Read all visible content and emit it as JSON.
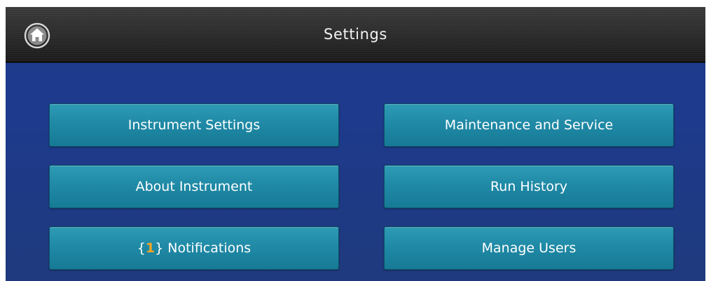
{
  "header": {
    "title": "Settings",
    "home_icon": "home-icon"
  },
  "colors": {
    "background": "#1e3a8a",
    "button": "#208aa6",
    "notification_count": "#f5a623"
  },
  "menu": {
    "instrument_settings": "Instrument Settings",
    "maintenance_service": "Maintenance and Service",
    "about_instrument": "About Instrument",
    "run_history": "Run History",
    "notifications": {
      "open_brace": "{",
      "count": "1",
      "close_brace": "}",
      "label": " Notifications"
    },
    "manage_users": "Manage Users"
  }
}
